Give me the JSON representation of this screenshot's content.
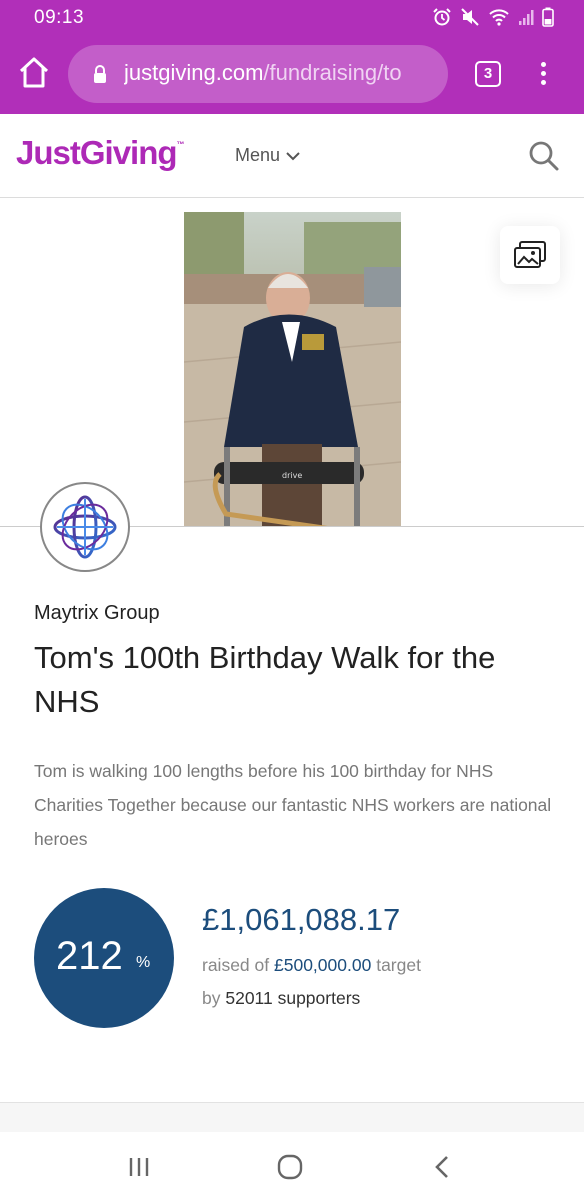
{
  "status_bar": {
    "time": "09:13",
    "icons": [
      "alarm-icon",
      "mute-icon",
      "wifi-icon",
      "signal-icon",
      "battery-icon"
    ]
  },
  "browser": {
    "url_domain": "justgiving.com",
    "url_path": "/fundraising/to",
    "tab_count": "3"
  },
  "header": {
    "logo": "JustGiving",
    "logo_mark": "™",
    "menu_label": "Menu"
  },
  "fundraiser": {
    "organisation": "Maytrix Group",
    "title": "Tom's 100th Birthday Walk for the NHS",
    "summary": "Tom is walking 100 lengths before his 100 birthday for NHS Charities Together because our fantastic NHS workers are national heroes"
  },
  "progress": {
    "percent": "212",
    "percent_sign": "%",
    "amount_raised": "£1,061,088.17",
    "raised_prefix": "raised of",
    "target_amount": "£500,000.00",
    "target_suffix": "target",
    "supporters_prefix": "by",
    "supporters_count": "52011 supporters"
  },
  "colors": {
    "brand_purple": "#ad29b6",
    "browser_purple": "#b12fb9",
    "progress_blue": "#1c4d7c"
  }
}
